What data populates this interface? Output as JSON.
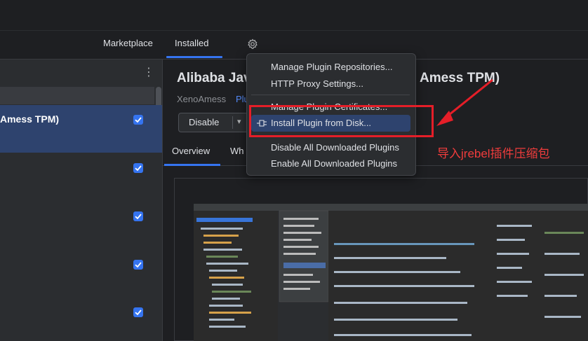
{
  "tabs": [
    {
      "label": "Marketplace",
      "active": false
    },
    {
      "label": "Installed",
      "active": true
    }
  ],
  "left_panel": {
    "selected_plugin_title": "Amess TPM)",
    "checkboxes_checked": 5
  },
  "plugin": {
    "title_start": "Alibaba Jav",
    "title_end": "Amess TPM)",
    "vendor": "XenoAmess",
    "vendor_extra": "Plu",
    "disable_button": "Disable",
    "dropdown_caret": "▾",
    "detail_tabs": [
      "Overview",
      "Wh"
    ]
  },
  "menu": {
    "items": [
      {
        "label": "Manage Plugin Repositories..."
      },
      {
        "label": "HTTP Proxy Settings..."
      },
      {
        "label": "Manage Plugin Certificates..."
      },
      {
        "label": "Install Plugin from Disk...",
        "highlighted": true
      },
      {
        "label": "Disable All Downloaded Plugins"
      },
      {
        "label": "Enable All Downloaded Plugins"
      }
    ]
  },
  "annotation": {
    "text": "导入jrebel插件压缩包",
    "color": "#e51e28"
  },
  "colors": {
    "accent": "#3574f0",
    "selection": "#2e436e",
    "background": "#1e1f22",
    "panel": "#2b2d30"
  }
}
